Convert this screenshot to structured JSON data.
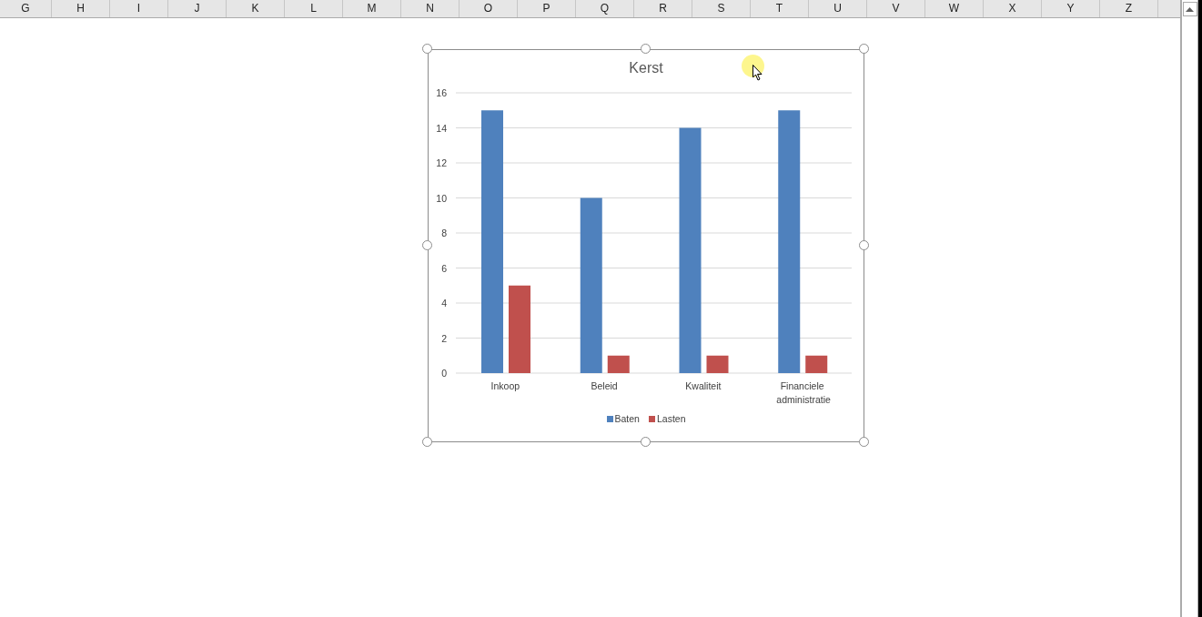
{
  "sheet": {
    "columns": [
      "G",
      "H",
      "I",
      "J",
      "K",
      "L",
      "M",
      "N",
      "O",
      "P",
      "Q",
      "R",
      "S",
      "T",
      "U",
      "V",
      "W",
      "X",
      "Y",
      "Z"
    ]
  },
  "chart": {
    "selected": true,
    "chart_data": {
      "type": "bar",
      "title": "Kerst",
      "categories": [
        "Inkoop",
        "Beleid",
        "Kwaliteit",
        "Financiele administratie"
      ],
      "series": [
        {
          "name": "Baten",
          "color": "#4f81bd",
          "values": [
            15,
            10,
            14,
            15
          ]
        },
        {
          "name": "Lasten",
          "color": "#c0504d",
          "values": [
            5,
            1,
            1,
            1
          ]
        }
      ],
      "grid": true,
      "ylim": [
        0,
        16
      ],
      "yticks": [
        0,
        2,
        4,
        6,
        8,
        10,
        12,
        14,
        16
      ]
    }
  }
}
